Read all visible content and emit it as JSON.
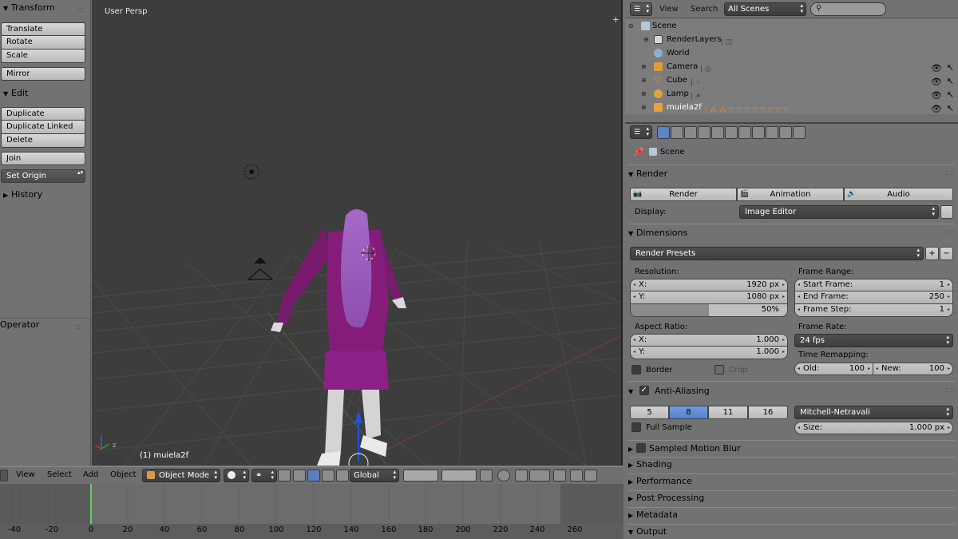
{
  "toolshelf": {
    "transform": {
      "title": "Transform",
      "translate": "Translate",
      "rotate": "Rotate",
      "scale": "Scale",
      "mirror": "Mirror"
    },
    "edit": {
      "title": "Edit",
      "duplicate": "Duplicate",
      "duplicate_linked": "Duplicate Linked",
      "delete": "Delete",
      "join": "Join",
      "set_origin": "Set Origin"
    },
    "history": {
      "title": "History"
    },
    "operator": {
      "title": "Operator"
    }
  },
  "viewport": {
    "view_label": "User Persp",
    "object_label": "(1) muiela2f"
  },
  "view_header": {
    "menus": [
      "View",
      "Select",
      "Add",
      "Object"
    ],
    "mode": "Object Mode",
    "orientation": "Global"
  },
  "timeline": {
    "ticks": [
      "-40",
      "-20",
      "0",
      "20",
      "40",
      "60",
      "80",
      "100",
      "120",
      "140",
      "160",
      "180",
      "200",
      "220",
      "240",
      "260"
    ]
  },
  "outliner": {
    "menus": {
      "view": "View",
      "search": "Search"
    },
    "scenes_select": "All Scenes",
    "rows": [
      "Scene",
      "RenderLayers",
      "World",
      "Camera",
      "Cube",
      "Lamp",
      "muiela2f"
    ]
  },
  "properties": {
    "context": "Scene",
    "render": {
      "title": "Render",
      "buttons": [
        "Render",
        "Animation",
        "Audio"
      ],
      "display_label": "Display:",
      "display_value": "Image Editor"
    },
    "dimensions": {
      "title": "Dimensions",
      "presets": "Render Presets",
      "resolution_label": "Resolution:",
      "res_x_label": "X:",
      "res_x": "1920 px",
      "res_y_label": "Y:",
      "res_y": "1080 px",
      "res_pct": "50%",
      "res_pct_fraction": 0.5,
      "aspect_label": "Aspect Ratio:",
      "asp_x_label": "X:",
      "asp_x": "1.000",
      "asp_y_label": "Y:",
      "asp_y": "1.000",
      "border": "Border",
      "crop": "Crop",
      "frame_range_label": "Frame Range:",
      "start_label": "Start Frame:",
      "start": "1",
      "end_label": "End Frame:",
      "end": "250",
      "step_label": "Frame Step:",
      "step": "1",
      "frame_rate_label": "Frame Rate:",
      "frame_rate": "24 fps",
      "remap_label": "Time Remapping:",
      "old_label": "Old:",
      "old": "100",
      "new_label": "New:",
      "new": "100"
    },
    "anti_aliasing": {
      "title": "Anti-Aliasing",
      "samples": [
        "5",
        "8",
        "11",
        "16"
      ],
      "filter": "Mitchell-Netravali",
      "full_sample": "Full Sample",
      "size_label": "Size:",
      "size": "1.000 px"
    },
    "collapsed_sections": [
      "Sampled Motion Blur",
      "Shading",
      "Performance",
      "Post Processing",
      "Metadata"
    ],
    "output_title": "Output"
  },
  "colors": {
    "accent": "#5682cd",
    "viewport_bg": "#3d3d3d",
    "panel_bg": "#727272"
  }
}
